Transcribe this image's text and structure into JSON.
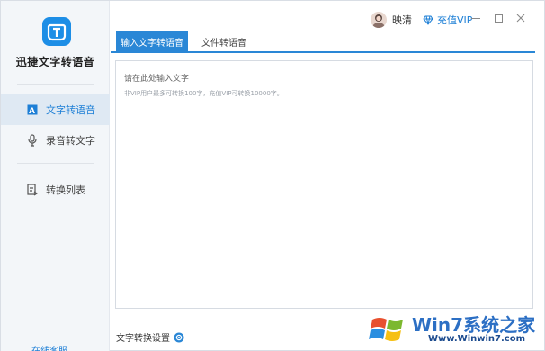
{
  "app": {
    "name": "迅捷文字转语音"
  },
  "sidebar": {
    "items": [
      {
        "label": "文字转语音",
        "icon": "text-to-speech-icon",
        "active": true
      },
      {
        "label": "录音转文字",
        "icon": "microphone-icon",
        "active": false
      },
      {
        "label": "转换列表",
        "icon": "convert-list-icon",
        "active": false
      }
    ],
    "bottom_link": "在线客服"
  },
  "header": {
    "username": "映清",
    "vip_label": "充值VIP"
  },
  "tabs": [
    {
      "label": "输入文字转语音",
      "active": true
    },
    {
      "label": "文件转语音",
      "active": false
    }
  ],
  "editor": {
    "placeholder": "请在此处输入文字",
    "hint": "非VIP用户最多可转换100字，充值VIP可转换10000字。"
  },
  "settings": {
    "label": "文字转换设置"
  },
  "watermark": {
    "text": "Win7系统之家",
    "url": "Www.Winwin7.com"
  },
  "colors": {
    "accent": "#2a87d6",
    "sidebar_bg": "#f3f6f9",
    "active_nav_bg": "#dfe9f3"
  }
}
